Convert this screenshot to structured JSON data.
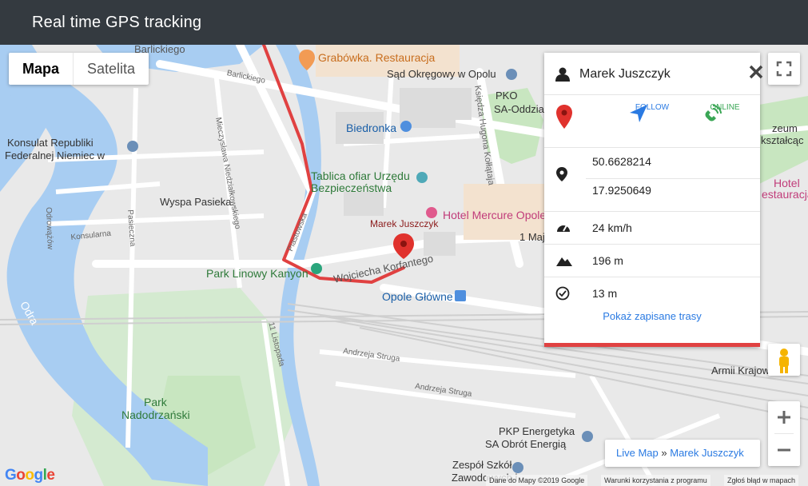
{
  "app": {
    "title": "Real time GPS tracking"
  },
  "map_type": {
    "map_label": "Mapa",
    "satellite_label": "Satelita",
    "selected": "Mapa"
  },
  "map_labels": {
    "barlickiego_top": "Barlickiego",
    "barlickiego_street": "Barlickiego",
    "grabowka": "Grabówka. Restauracja",
    "sad": "Sąd Okręgowy w Opolu",
    "pko": "PKO",
    "sa_oddzial": "SA-Oddzia",
    "biedronka": "Biedronka",
    "konsulat1": "Konsulat Republiki",
    "konsulat2": "Federalnej Niemiec w",
    "mieczyslawa": "Mieczysława Niedziałkowskiego",
    "ksiedza": "Księdza Hugona Kołłątaja",
    "tablica1": "Tablica ofiar Urzędu",
    "tablica2": "Bezpieczeństwa",
    "wyspa": "Wyspa Pasieka",
    "hotel_mercure": "Hotel Mercure Opole",
    "marker_name": "Marek Juszczyk",
    "odrowazow": "Odrowążów",
    "konsularna": "Konsularna",
    "pasieczna": "Pasieczna",
    "piastowska": "Piastowska",
    "park_linowy": "Park Linowy Kanyon",
    "wojciecha": "Wojciecha Korfantego",
    "opole_glowne": "Opole Główne",
    "odra": "Odra",
    "listopada": "11 Listopada",
    "andrzeja1": "Andrzeja Struga",
    "andrzeja2": "Andrzeja Struga",
    "park_nadodrz1": "Park",
    "park_nadodrz2": "Nadodrzański",
    "pkp1": "PKP Energetyka",
    "pkp2": "SA Obrót Energią",
    "zespol1": "Zespół Szkół",
    "zespol2": "Zawodowych i",
    "armii": "Armii Krajow",
    "muzeum1": "zeum",
    "muzeum2": "kształcąc",
    "hotel_r1": "Hotel",
    "hotel_r2": "estauracja",
    "maj": "1 Maj",
    "google": "Google",
    "attribution_data": "Dane do Mapy ©2019 Google",
    "attribution_terms": "Warunki korzystania z programu",
    "attribution_report": "Zgłoś błąd w mapach"
  },
  "panel": {
    "user_name": "Marek Juszczyk",
    "follow_label": "FOLLOW",
    "online_label": "ONLINE",
    "latitude": "50.6628214",
    "longitude": "17.9250649",
    "speed": "24 km/h",
    "altitude": "196 m",
    "accuracy": "13 m",
    "saved_routes_link": "Pokaż zapisane trasy"
  },
  "breadcrumb": {
    "root": "Live Map",
    "separator": "»",
    "current": "Marek Juszczyk"
  },
  "colors": {
    "topbar": "#343a40",
    "route": "#e04141",
    "river": "#a8cdf2",
    "online": "#3aa655",
    "follow": "#2a7ae2"
  }
}
